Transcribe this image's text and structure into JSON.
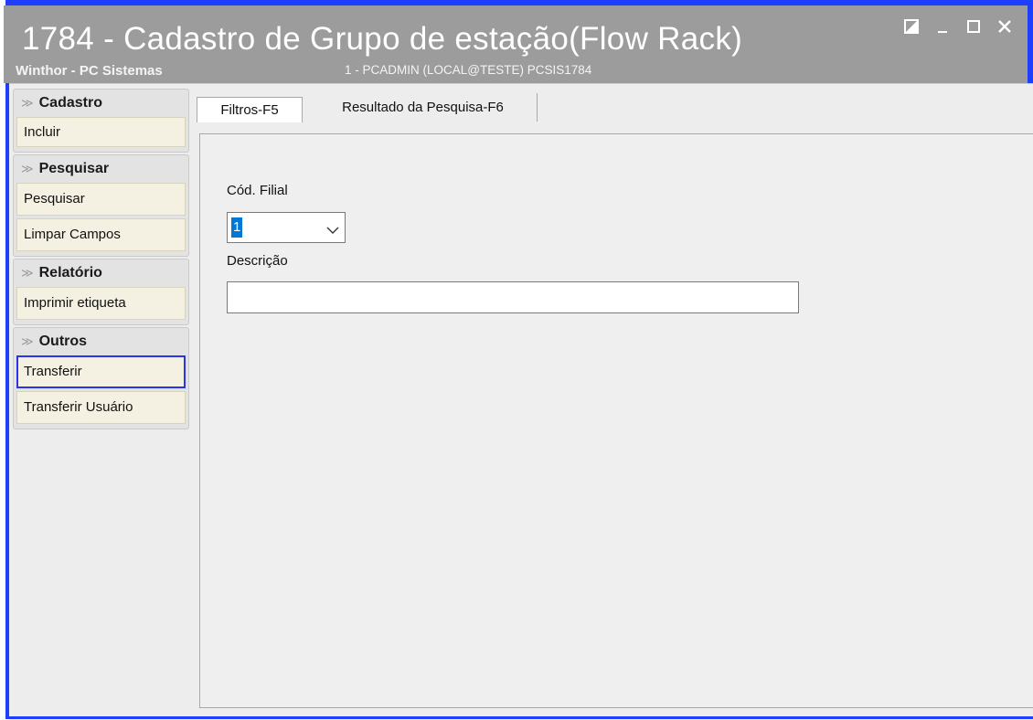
{
  "window": {
    "title": "1784 - Cadastro de Grupo de estação(Flow Rack)",
    "app_name": "Winthor - PC Sistemas",
    "session_info": "1 - PCADMIN (LOCAL@TESTE)   PCSIS1784",
    "accent_color": "#1f3fff",
    "titlebar_color": "#9c9c9c"
  },
  "sidebar": {
    "groups": [
      {
        "title": "Cadastro",
        "items": [
          {
            "label": "Incluir"
          }
        ]
      },
      {
        "title": "Pesquisar",
        "items": [
          {
            "label": "Pesquisar"
          },
          {
            "label": "Limpar Campos"
          }
        ]
      },
      {
        "title": "Relatório",
        "items": [
          {
            "label": "Imprimir etiqueta"
          }
        ]
      },
      {
        "title": "Outros",
        "items": [
          {
            "label": "Transferir"
          },
          {
            "label": "Transferir Usuário"
          }
        ]
      }
    ]
  },
  "tabs": [
    {
      "label": "Filtros-F5"
    },
    {
      "label": "Resultado da Pesquisa-F6"
    }
  ],
  "filters": {
    "filial_label": "Cód. Filial",
    "filial_value": "1",
    "descricao_label": "Descrição",
    "descricao_value": ""
  }
}
